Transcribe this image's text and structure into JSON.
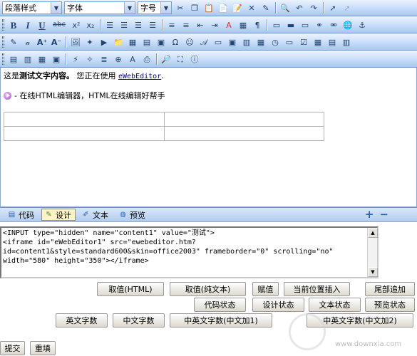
{
  "toolbar1": {
    "style_select": "段落样式",
    "font_select": "字体",
    "size_select": "字号"
  },
  "editor": {
    "line1_prefix": "这是",
    "line1_bold": "测试文字内容。",
    "line1_middle": " 您正在使用 ",
    "line1_link": "eWebEditor",
    "line1_suffix": ".",
    "line2": "- 在线HTML编辑器，HTML在线编辑好帮手"
  },
  "modes": {
    "code": "代码",
    "design": "设计",
    "text": "文本",
    "preview": "预览"
  },
  "code_area": {
    "value": "<INPUT type=\"hidden\" name=\"content1\" value=\"测试\">\n<iframe id=\"eWebEditor1\" src=\"ewebeditor.htm?\nid=content1&style=standard600&skin=office2003\" frameborder=\"0\" scrolling=\"no\"\nwidth=\"580\" height=\"350\"></iframe>"
  },
  "buttons": {
    "get_html": "取值(HTML)",
    "get_text": "取值(纯文本)",
    "set_value": "赋值",
    "insert_at_cursor": "当前位置插入",
    "append_end": "尾部追加",
    "code_state": "代码状态",
    "design_state": "设计状态",
    "text_state": "文本状态",
    "preview_state": "预览状态",
    "en_count": "英文字数",
    "cn_count": "中文字数",
    "mixed_count_1": "中英文字数(中文加1)",
    "mixed_count_2": "中英文字数(中文加2)",
    "submit": "提交",
    "reset": "重填"
  },
  "watermark": "www.downxia.com",
  "colors": {
    "toolbar_top": "#eaf2fd",
    "toolbar_bottom": "#a9c7ef",
    "active_tab": "#fdf3c4"
  }
}
